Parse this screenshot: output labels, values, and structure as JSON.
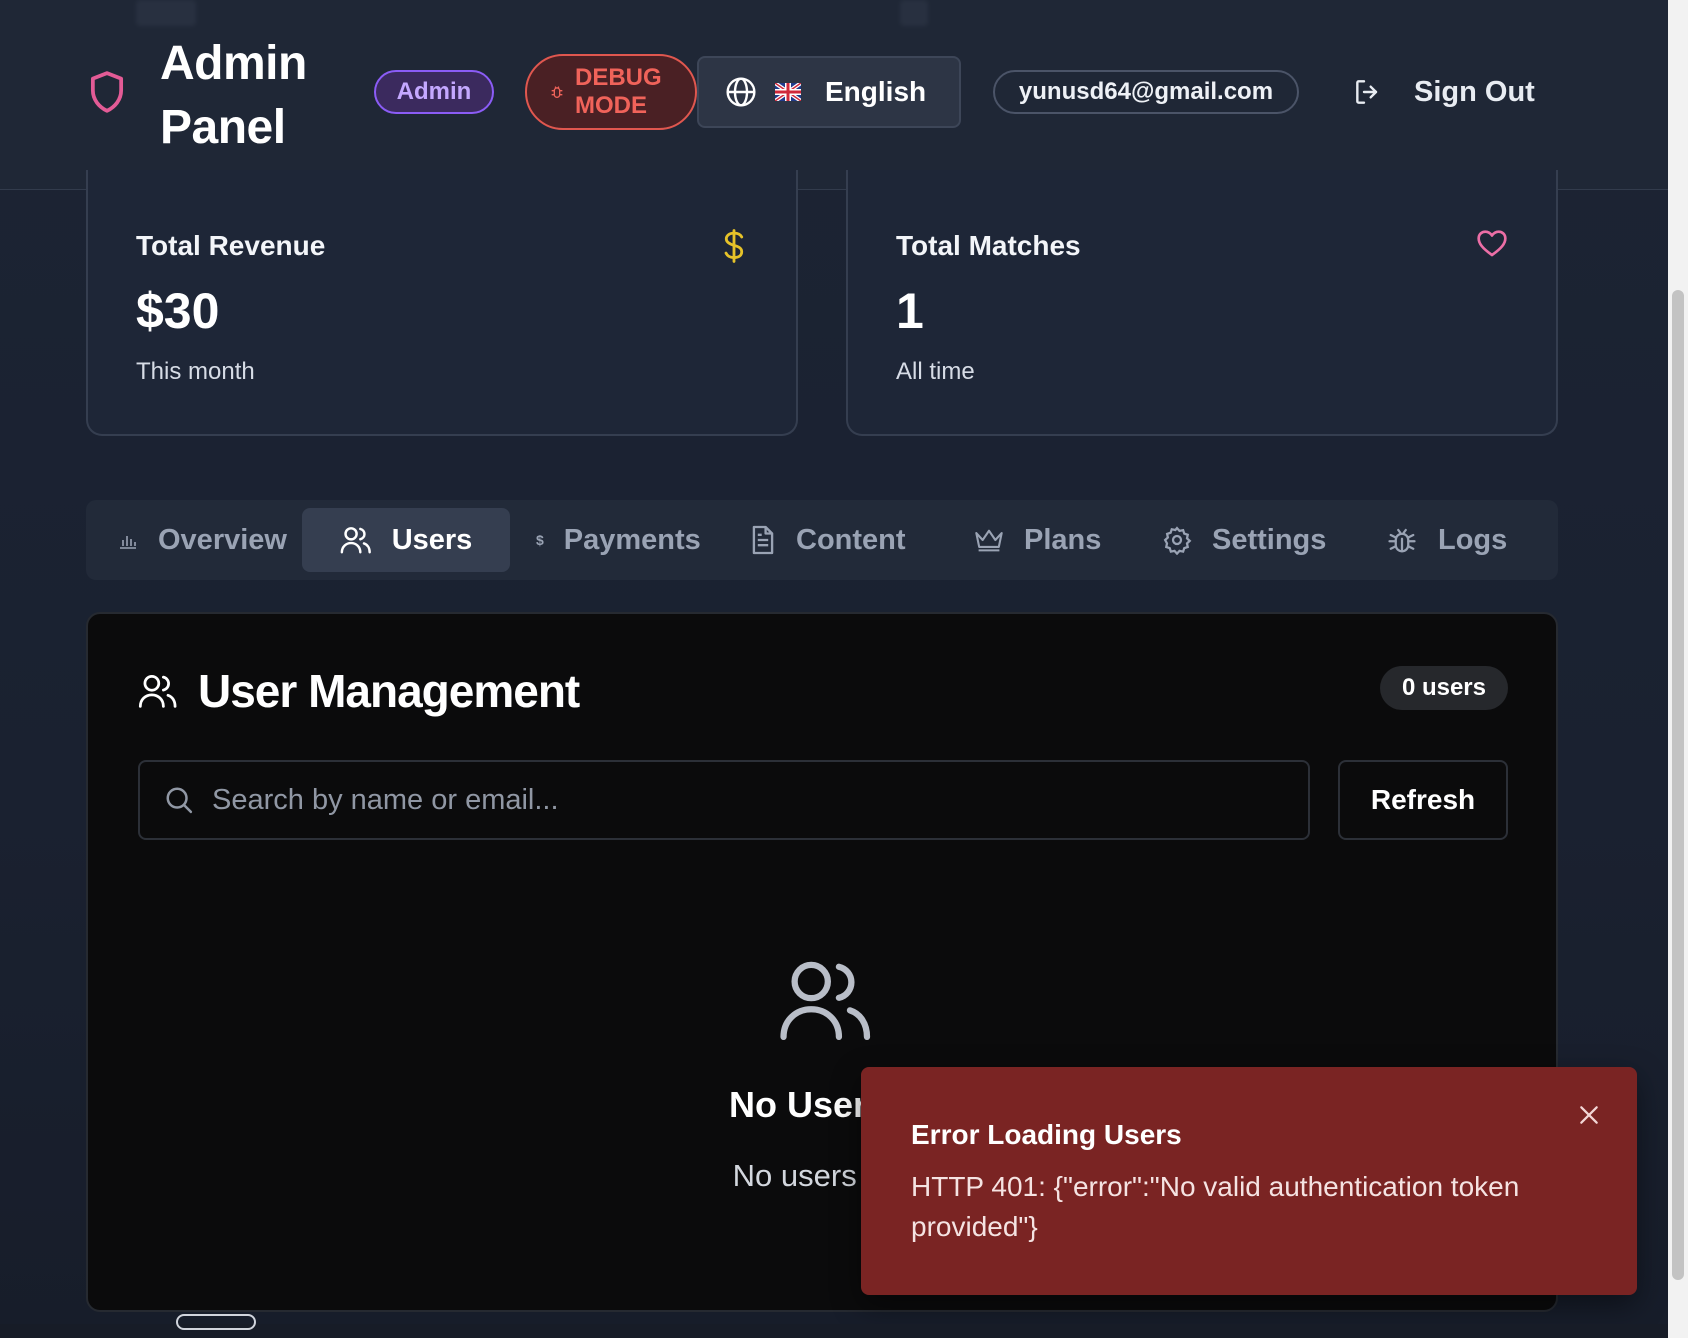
{
  "header": {
    "title": "Admin Panel",
    "admin_badge": "Admin",
    "debug_badge": "DEBUG MODE",
    "language": "English",
    "email": "yunusd64@gmail.com",
    "sign_out": "Sign Out"
  },
  "stats": [
    {
      "label": "Total Revenue",
      "value": "$30",
      "sub": "This month",
      "icon": "dollar-icon",
      "icon_color": "#e6c229"
    },
    {
      "label": "Total Matches",
      "value": "1",
      "sub": "All time",
      "icon": "heart-icon",
      "icon_color": "#ec6ea6"
    }
  ],
  "tabs": [
    {
      "label": "Overview",
      "icon": "bar-chart-icon",
      "active": false
    },
    {
      "label": "Users",
      "icon": "users-icon",
      "active": true
    },
    {
      "label": "Payments",
      "icon": "dollar-icon",
      "active": false
    },
    {
      "label": "Content",
      "icon": "document-icon",
      "active": false
    },
    {
      "label": "Plans",
      "icon": "crown-icon",
      "active": false
    },
    {
      "label": "Settings",
      "icon": "gear-icon",
      "active": false
    },
    {
      "label": "Logs",
      "icon": "bug-icon",
      "active": false
    }
  ],
  "user_management": {
    "title": "User Management",
    "count": "0 users",
    "search_placeholder": "Search by name or email...",
    "refresh": "Refresh",
    "empty_title": "No Users F",
    "empty_sub": "No users ava"
  },
  "toast": {
    "title": "Error Loading Users",
    "message": "HTTP 401: {\"error\":\"No valid authentication token provided\"}"
  },
  "colors": {
    "shield": "#e35b96",
    "accent_purple": "#8b5cf6",
    "debug_red": "#f0635a",
    "toast_bg": "#7a2423"
  }
}
